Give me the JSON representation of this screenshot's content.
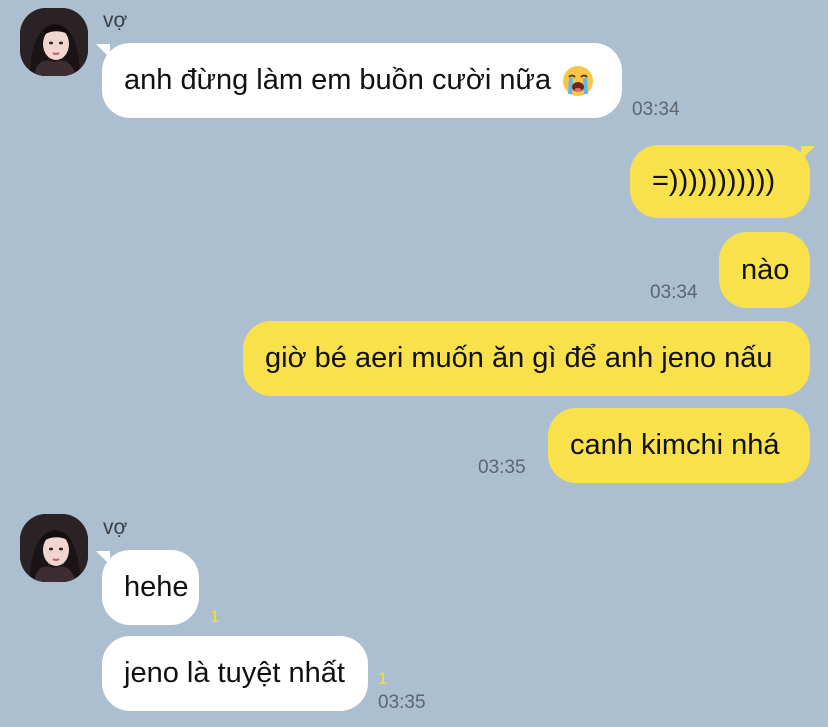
{
  "chat": {
    "group1": {
      "sender": "vợ",
      "msg1": "anh đừng làm em buồn cười nữa",
      "msg1_emoji": "crying-face-icon",
      "time": "03:34"
    },
    "outgoing": {
      "msg1": "=)))))))))))",
      "msg2": "nào",
      "time1": "03:34",
      "msg3": "giờ bé aeri muốn ăn gì để anh jeno nấu",
      "msg4": "canh kimchi nhá",
      "time2": "03:35"
    },
    "group2": {
      "sender": "vợ",
      "msg1": "hehe",
      "msg1_unread": "1",
      "msg2": "jeno là tuyệt nhất",
      "msg2_unread": "1",
      "time": "03:35"
    }
  },
  "colors": {
    "background": "#abbfd1",
    "incoming_bubble": "#ffffff",
    "outgoing_bubble": "#f9e14b",
    "unread": "#f2df3a"
  }
}
